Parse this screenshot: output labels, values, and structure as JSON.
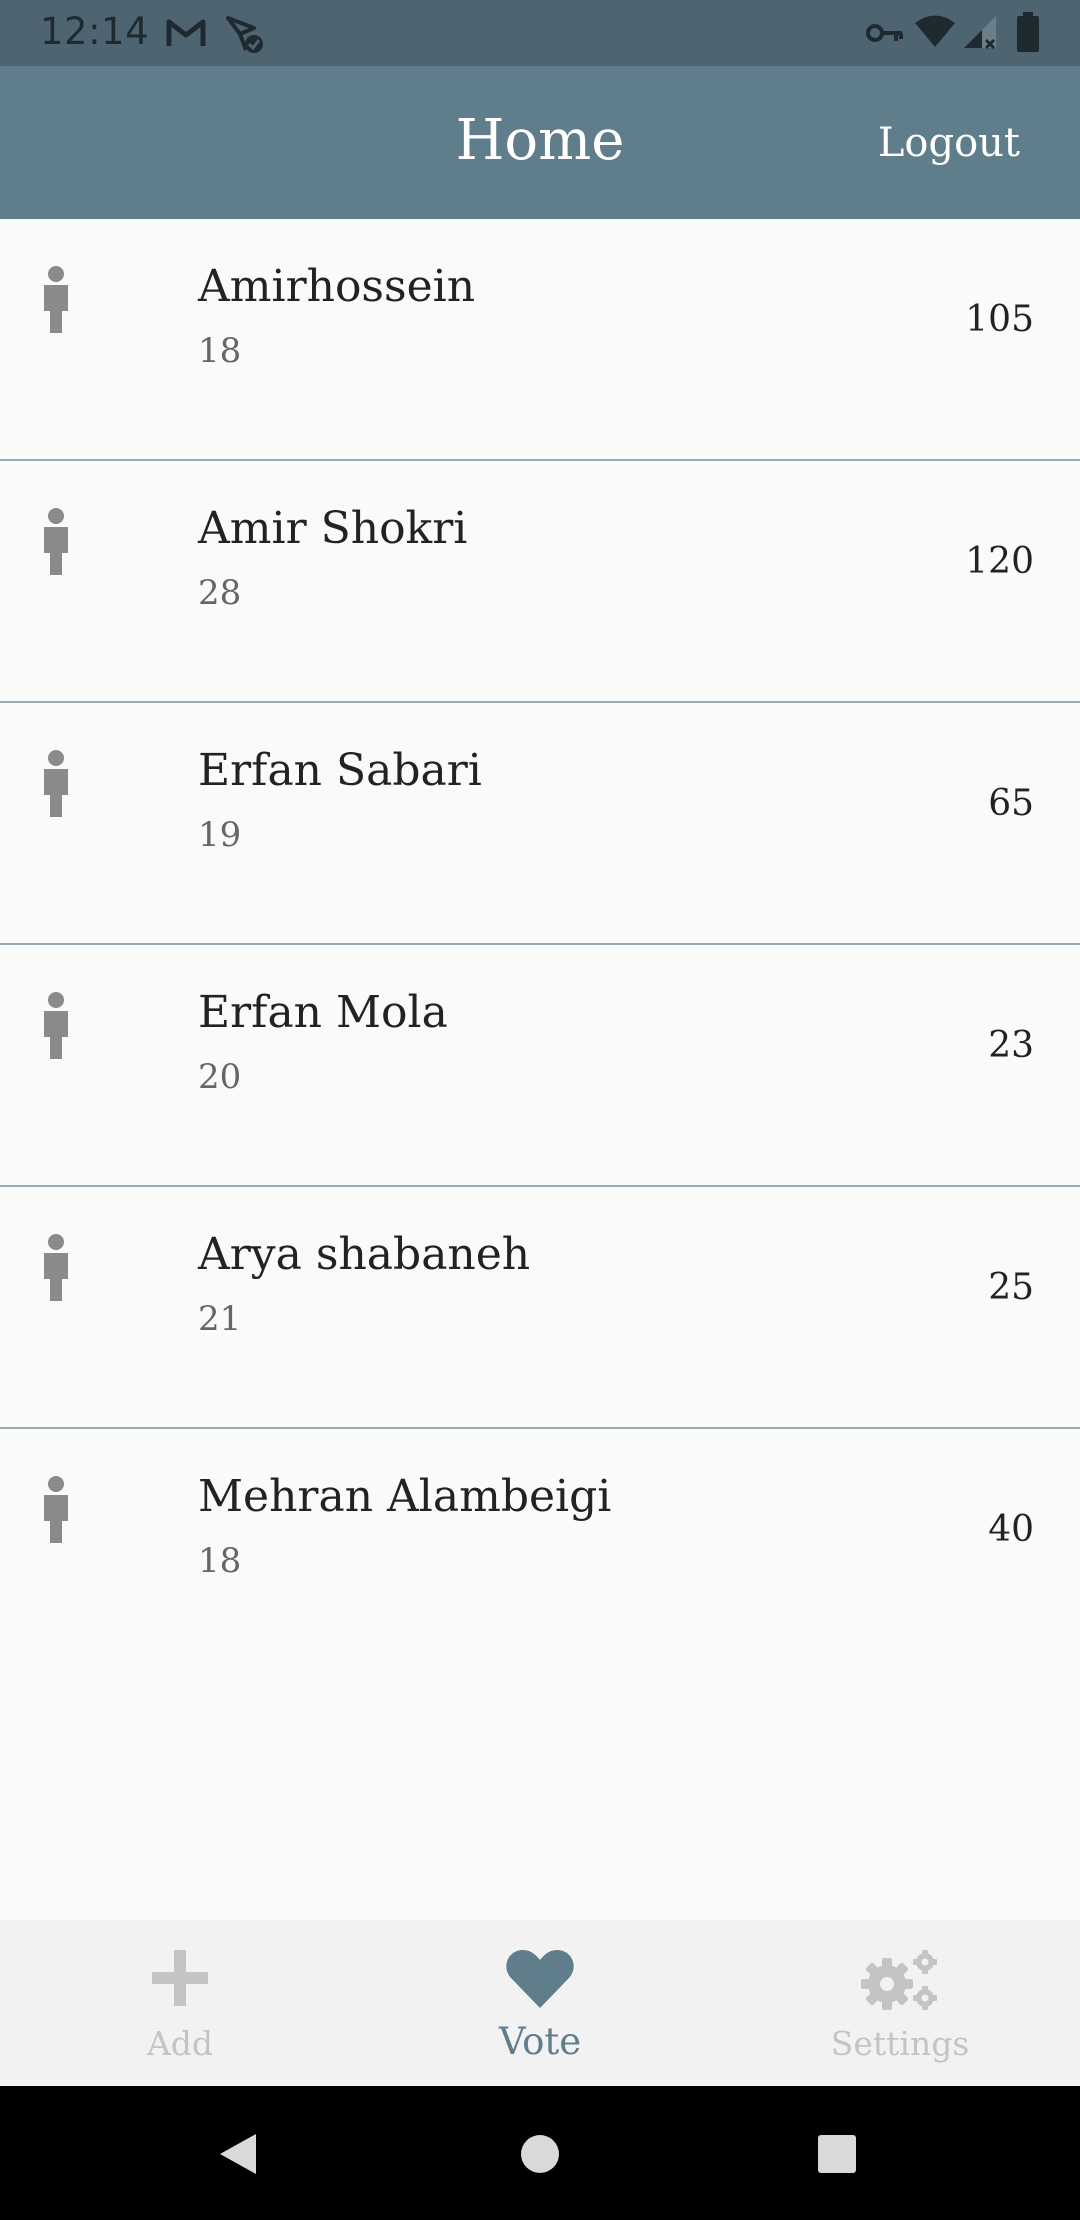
{
  "status_bar": {
    "time": "12:14",
    "icons": [
      "gmail-icon",
      "nfc-check-icon",
      "vpn-key-icon",
      "wifi-icon",
      "signal-icon",
      "battery-icon"
    ]
  },
  "app_bar": {
    "title": "Home",
    "logout_label": "Logout",
    "background": "#607d8b"
  },
  "people": [
    {
      "name": "Amirhossein",
      "age": "18",
      "votes": "105"
    },
    {
      "name": "Amir Shokri",
      "age": "28",
      "votes": "120"
    },
    {
      "name": "Erfan Sabari",
      "age": "19",
      "votes": "65"
    },
    {
      "name": "Erfan Mola",
      "age": "20",
      "votes": "23"
    },
    {
      "name": "Arya shabaneh",
      "age": "21",
      "votes": "25"
    },
    {
      "name": "Mehran Alambeigi",
      "age": "18",
      "votes": "40"
    }
  ],
  "bottom_nav": {
    "items": [
      {
        "label": "Add",
        "icon": "plus-icon",
        "active": false
      },
      {
        "label": "Vote",
        "icon": "heart-icon",
        "active": true
      },
      {
        "label": "Settings",
        "icon": "gears-icon",
        "active": false
      }
    ],
    "active_color": "#607d8b",
    "inactive_color": "#c4c4c4"
  },
  "system_nav": {
    "icons": [
      "back-icon",
      "home-icon",
      "recents-icon"
    ]
  }
}
